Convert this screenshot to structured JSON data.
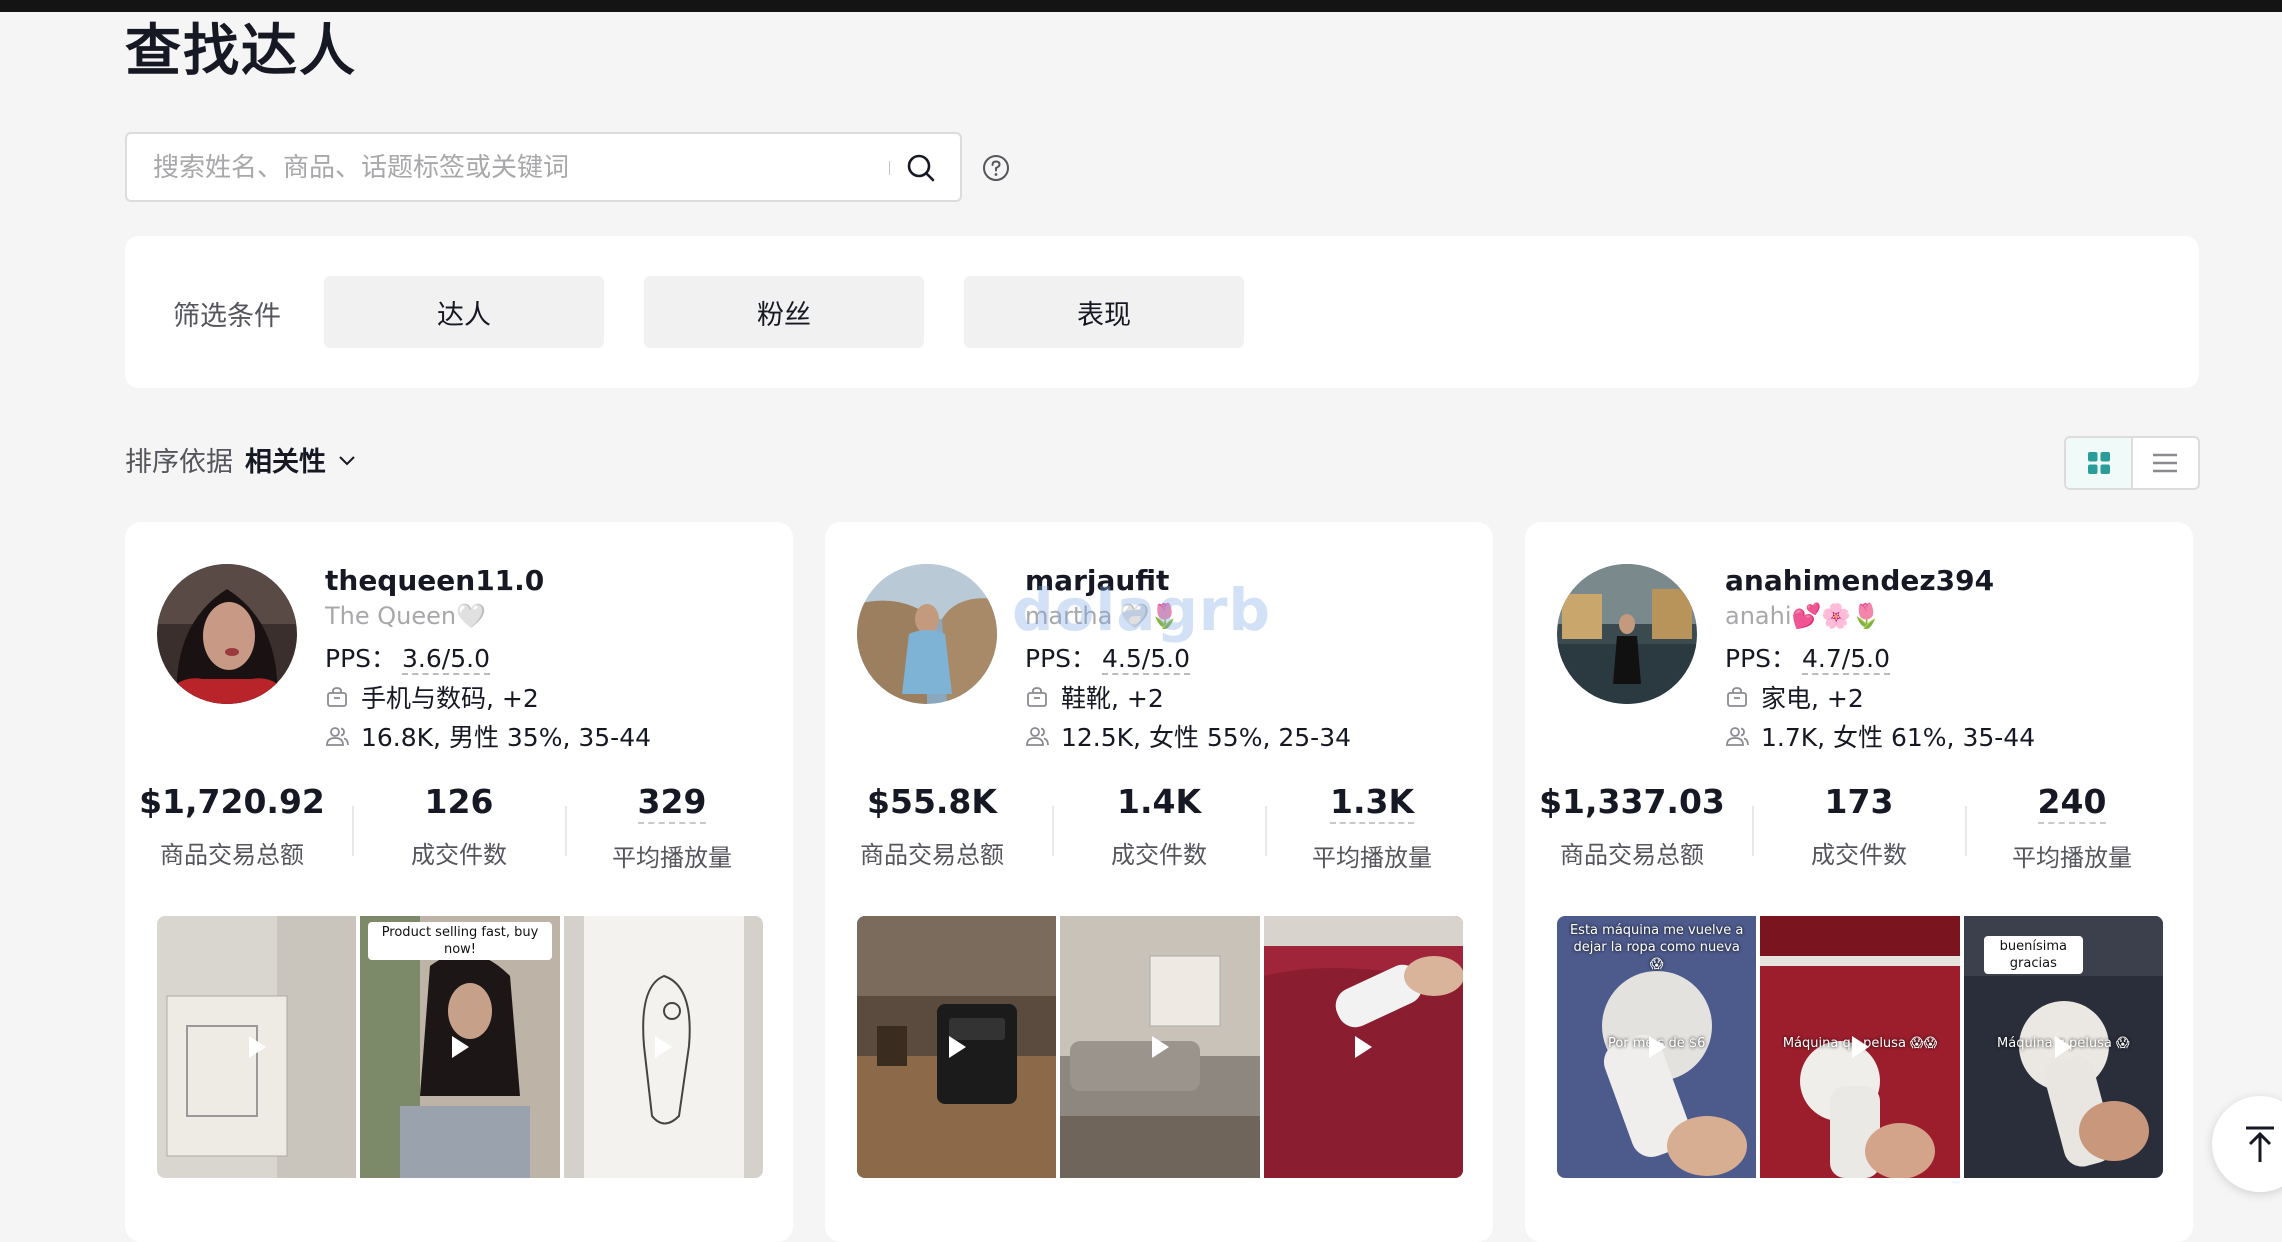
{
  "page": {
    "title": "查找达人"
  },
  "search": {
    "placeholder": "搜索姓名、商品、话题标签或关键词",
    "icon": "search-icon",
    "help_icon": "help-circle-icon"
  },
  "filters": {
    "label": "筛选条件",
    "buttons": [
      "达人",
      "粉丝",
      "表现"
    ]
  },
  "sort": {
    "label": "排序依据",
    "value": "相关性"
  },
  "view_toggle": {
    "active": "grid",
    "options": [
      "grid",
      "list"
    ],
    "accent": "#2a9d9a"
  },
  "creators": [
    {
      "handle": "thequeen11.0",
      "nickname": "The Queen🤍",
      "pps_label": "PPS：",
      "pps_value": "3.6/5.0",
      "category": "手机与数码, +2",
      "audience": "16.8K, 男性 35%, 35-44",
      "stats": [
        {
          "value": "$1,720.92",
          "label": "商品交易总额"
        },
        {
          "value": "126",
          "label": "成交件数"
        },
        {
          "value": "329",
          "label": "平均播放量"
        }
      ],
      "thumbs": [
        {
          "caption": "",
          "mid": ""
        },
        {
          "caption": "Product selling fast, buy now!",
          "mid": ""
        },
        {
          "caption": "",
          "mid": ""
        }
      ]
    },
    {
      "handle": "marjaufit",
      "nickname": "martha 🤍🌷",
      "pps_label": "PPS：",
      "pps_value": "4.5/5.0",
      "category": "鞋靴, +2",
      "audience": "12.5K, 女性 55%, 25-34",
      "stats": [
        {
          "value": "$55.8K",
          "label": "商品交易总额"
        },
        {
          "value": "1.4K",
          "label": "成交件数"
        },
        {
          "value": "1.3K",
          "label": "平均播放量"
        }
      ],
      "thumbs": [
        {
          "caption": "",
          "mid": ""
        },
        {
          "caption": "",
          "mid": ""
        },
        {
          "caption": "",
          "mid": ""
        }
      ]
    },
    {
      "handle": "anahimendez394",
      "nickname": "anahi💕🌸🌷",
      "pps_label": "PPS：",
      "pps_value": "4.7/5.0",
      "category": "家电, +2",
      "audience": "1.7K, 女性 61%, 35-44",
      "stats": [
        {
          "value": "$1,337.03",
          "label": "商品交易总额"
        },
        {
          "value": "173",
          "label": "成交件数"
        },
        {
          "value": "240",
          "label": "平均播放量"
        }
      ],
      "thumbs": [
        {
          "caption": "Esta máquina me vuelve a dejar la ropa como nueva 😱",
          "mid": "Por me   s de $6"
        },
        {
          "caption": "",
          "mid": "Máquina qu   pelusa 😱😱"
        },
        {
          "caption": "buenísima gracias",
          "mid": "Máquina q    pelusa 😱"
        }
      ]
    }
  ],
  "watermark": "dolagrb"
}
